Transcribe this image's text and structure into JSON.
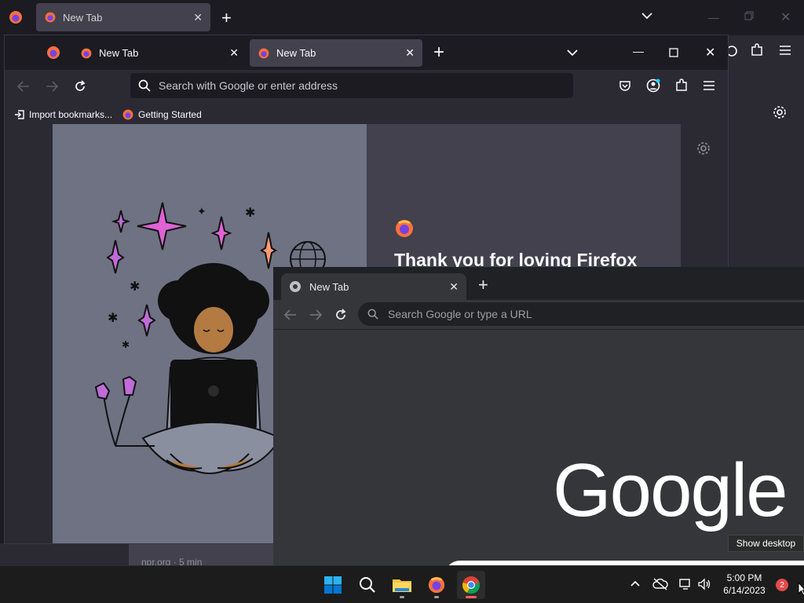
{
  "background_firefox": {
    "tab_label": "New Tab",
    "card_text": "npr.org · 5 min"
  },
  "firefox": {
    "tabs": [
      {
        "label": "New Tab"
      },
      {
        "label": "New Tab"
      }
    ],
    "url_placeholder": "Search with Google or enter address",
    "bookmarks": [
      {
        "label": "Import bookmarks..."
      },
      {
        "label": "Getting Started"
      }
    ],
    "headline": "Thank you for loving Firefox"
  },
  "chrome": {
    "tab_label": "New Tab",
    "omnibox_placeholder": "Search Google or type a URL",
    "logo_text": "Google"
  },
  "tooltip": "Show desktop",
  "taskbar": {
    "time": "5:00 PM",
    "date": "6/14/2023",
    "notification_count": "2"
  },
  "colors": {
    "firefox_dark": "#1c1b22",
    "firefox_toolbar": "#2b2a33",
    "chrome_dark": "#202124",
    "chrome_toolbar": "#35363a",
    "windows_blue": "#0078d4"
  }
}
